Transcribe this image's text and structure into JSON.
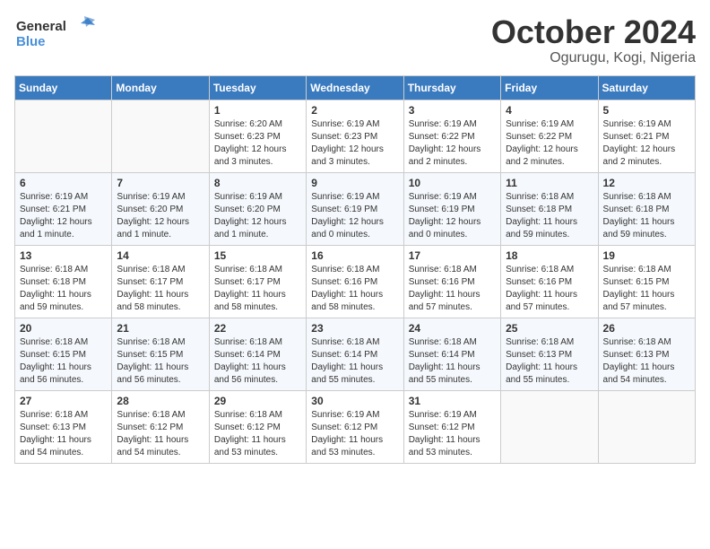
{
  "header": {
    "logo_general": "General",
    "logo_blue": "Blue",
    "month": "October 2024",
    "location": "Ogurugu, Kogi, Nigeria"
  },
  "weekdays": [
    "Sunday",
    "Monday",
    "Tuesday",
    "Wednesday",
    "Thursday",
    "Friday",
    "Saturday"
  ],
  "weeks": [
    [
      {
        "day": "",
        "info": ""
      },
      {
        "day": "",
        "info": ""
      },
      {
        "day": "1",
        "info": "Sunrise: 6:20 AM\nSunset: 6:23 PM\nDaylight: 12 hours and 3 minutes."
      },
      {
        "day": "2",
        "info": "Sunrise: 6:19 AM\nSunset: 6:23 PM\nDaylight: 12 hours and 3 minutes."
      },
      {
        "day": "3",
        "info": "Sunrise: 6:19 AM\nSunset: 6:22 PM\nDaylight: 12 hours and 2 minutes."
      },
      {
        "day": "4",
        "info": "Sunrise: 6:19 AM\nSunset: 6:22 PM\nDaylight: 12 hours and 2 minutes."
      },
      {
        "day": "5",
        "info": "Sunrise: 6:19 AM\nSunset: 6:21 PM\nDaylight: 12 hours and 2 minutes."
      }
    ],
    [
      {
        "day": "6",
        "info": "Sunrise: 6:19 AM\nSunset: 6:21 PM\nDaylight: 12 hours and 1 minute."
      },
      {
        "day": "7",
        "info": "Sunrise: 6:19 AM\nSunset: 6:20 PM\nDaylight: 12 hours and 1 minute."
      },
      {
        "day": "8",
        "info": "Sunrise: 6:19 AM\nSunset: 6:20 PM\nDaylight: 12 hours and 1 minute."
      },
      {
        "day": "9",
        "info": "Sunrise: 6:19 AM\nSunset: 6:19 PM\nDaylight: 12 hours and 0 minutes."
      },
      {
        "day": "10",
        "info": "Sunrise: 6:19 AM\nSunset: 6:19 PM\nDaylight: 12 hours and 0 minutes."
      },
      {
        "day": "11",
        "info": "Sunrise: 6:18 AM\nSunset: 6:18 PM\nDaylight: 11 hours and 59 minutes."
      },
      {
        "day": "12",
        "info": "Sunrise: 6:18 AM\nSunset: 6:18 PM\nDaylight: 11 hours and 59 minutes."
      }
    ],
    [
      {
        "day": "13",
        "info": "Sunrise: 6:18 AM\nSunset: 6:18 PM\nDaylight: 11 hours and 59 minutes."
      },
      {
        "day": "14",
        "info": "Sunrise: 6:18 AM\nSunset: 6:17 PM\nDaylight: 11 hours and 58 minutes."
      },
      {
        "day": "15",
        "info": "Sunrise: 6:18 AM\nSunset: 6:17 PM\nDaylight: 11 hours and 58 minutes."
      },
      {
        "day": "16",
        "info": "Sunrise: 6:18 AM\nSunset: 6:16 PM\nDaylight: 11 hours and 58 minutes."
      },
      {
        "day": "17",
        "info": "Sunrise: 6:18 AM\nSunset: 6:16 PM\nDaylight: 11 hours and 57 minutes."
      },
      {
        "day": "18",
        "info": "Sunrise: 6:18 AM\nSunset: 6:16 PM\nDaylight: 11 hours and 57 minutes."
      },
      {
        "day": "19",
        "info": "Sunrise: 6:18 AM\nSunset: 6:15 PM\nDaylight: 11 hours and 57 minutes."
      }
    ],
    [
      {
        "day": "20",
        "info": "Sunrise: 6:18 AM\nSunset: 6:15 PM\nDaylight: 11 hours and 56 minutes."
      },
      {
        "day": "21",
        "info": "Sunrise: 6:18 AM\nSunset: 6:15 PM\nDaylight: 11 hours and 56 minutes."
      },
      {
        "day": "22",
        "info": "Sunrise: 6:18 AM\nSunset: 6:14 PM\nDaylight: 11 hours and 56 minutes."
      },
      {
        "day": "23",
        "info": "Sunrise: 6:18 AM\nSunset: 6:14 PM\nDaylight: 11 hours and 55 minutes."
      },
      {
        "day": "24",
        "info": "Sunrise: 6:18 AM\nSunset: 6:14 PM\nDaylight: 11 hours and 55 minutes."
      },
      {
        "day": "25",
        "info": "Sunrise: 6:18 AM\nSunset: 6:13 PM\nDaylight: 11 hours and 55 minutes."
      },
      {
        "day": "26",
        "info": "Sunrise: 6:18 AM\nSunset: 6:13 PM\nDaylight: 11 hours and 54 minutes."
      }
    ],
    [
      {
        "day": "27",
        "info": "Sunrise: 6:18 AM\nSunset: 6:13 PM\nDaylight: 11 hours and 54 minutes."
      },
      {
        "day": "28",
        "info": "Sunrise: 6:18 AM\nSunset: 6:12 PM\nDaylight: 11 hours and 54 minutes."
      },
      {
        "day": "29",
        "info": "Sunrise: 6:18 AM\nSunset: 6:12 PM\nDaylight: 11 hours and 53 minutes."
      },
      {
        "day": "30",
        "info": "Sunrise: 6:19 AM\nSunset: 6:12 PM\nDaylight: 11 hours and 53 minutes."
      },
      {
        "day": "31",
        "info": "Sunrise: 6:19 AM\nSunset: 6:12 PM\nDaylight: 11 hours and 53 minutes."
      },
      {
        "day": "",
        "info": ""
      },
      {
        "day": "",
        "info": ""
      }
    ]
  ]
}
